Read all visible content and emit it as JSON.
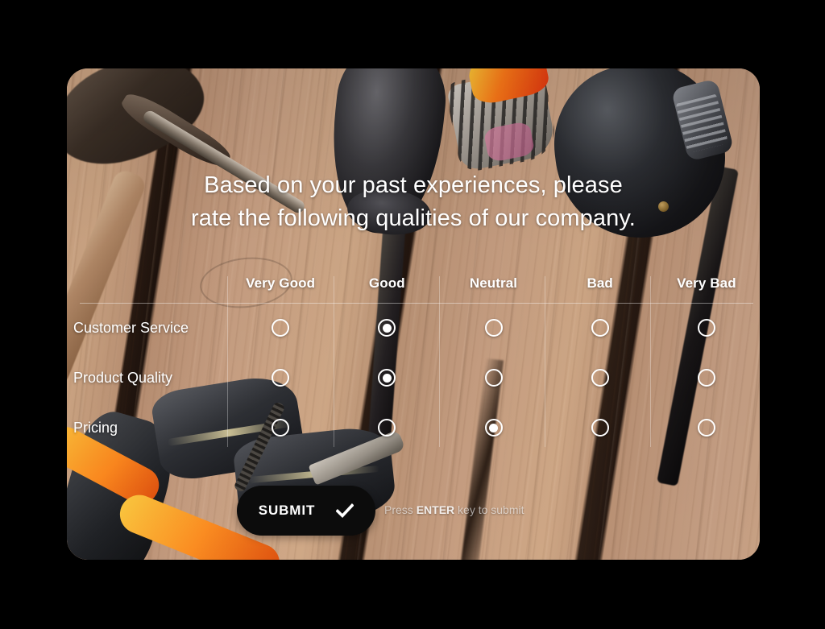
{
  "survey": {
    "question": {
      "line1": "Based on your past experiences, please",
      "line2": "rate the following qualities of our company."
    },
    "columns": [
      {
        "label": "Very Good"
      },
      {
        "label": "Good"
      },
      {
        "label": "Neutral"
      },
      {
        "label": "Bad"
      },
      {
        "label": "Very Bad"
      }
    ],
    "rows": [
      {
        "label": "Customer Service",
        "selected_index": 1
      },
      {
        "label": "Product Quality",
        "selected_index": 1
      },
      {
        "label": "Pricing",
        "selected_index": 2
      }
    ],
    "footer": {
      "submit_label": "SUBMIT",
      "submit_icon": "check-icon",
      "hint_prefix": "Press ",
      "hint_key": "ENTER",
      "hint_suffix": " key to submit"
    },
    "colors": {
      "page_background": "#000000",
      "submit_background": "#0c0c0c",
      "text": "#ffffff",
      "divider": "rgba(255,255,255,0.42)",
      "hint_text": "rgba(255,255,255,0.60)"
    }
  }
}
